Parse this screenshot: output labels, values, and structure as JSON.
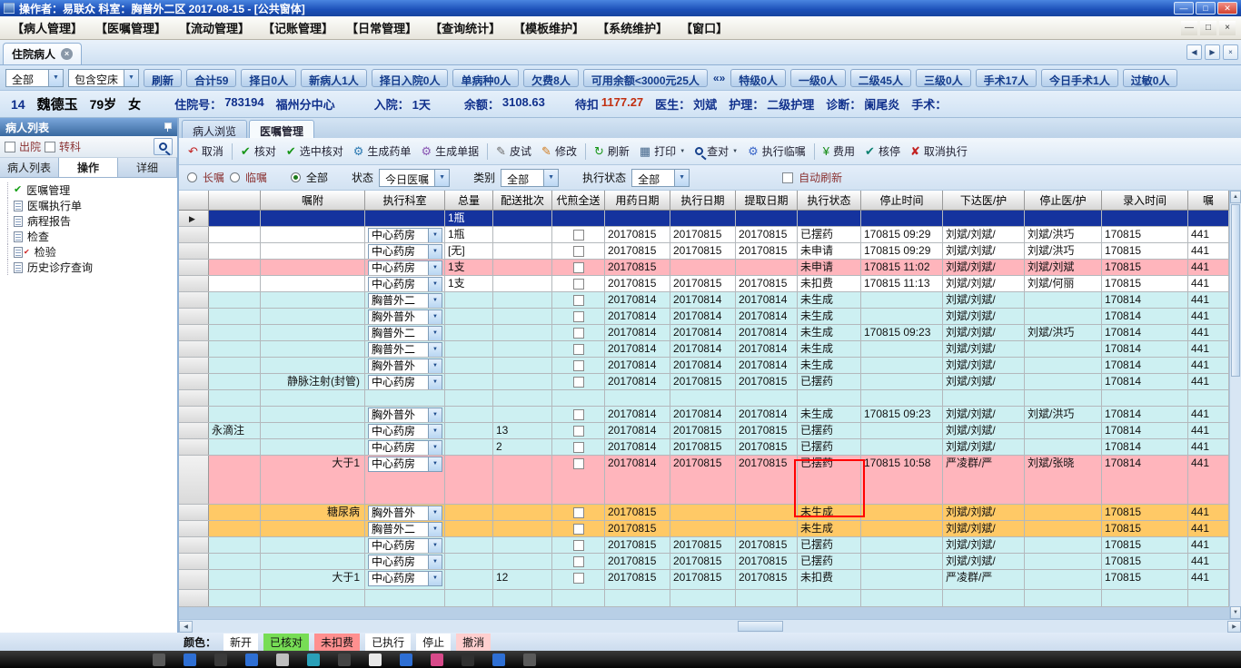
{
  "titlebar": {
    "title": "操作者：易联众 科室：胸普外二区 2017-08-15 - [公共窗体]",
    "min": "—",
    "max": "□",
    "close": "✕"
  },
  "menubar": {
    "items": [
      "【病人管理】",
      "【医嘱管理】",
      "【流动管理】",
      "【记账管理】",
      "【日常管理】",
      "【查询统计】",
      "【模板维护】",
      "【系统维护】",
      "【窗口】"
    ]
  },
  "doc_tabs": {
    "active": "住院病人"
  },
  "stats_bar": {
    "combos": [
      "全部",
      "包含空床"
    ],
    "buttons": [
      "刷新",
      "合计59",
      "择日0人",
      "新病人1人",
      "择日入院0人",
      "单病种0人",
      "欠费8人",
      "可用余额<3000元25人",
      "特级0人",
      "一级0人",
      "二级45人",
      "三级0人",
      "手术17人",
      "今日手术1人",
      "过敏0人"
    ],
    "more": "«»"
  },
  "patientbar": {
    "bed": "14",
    "name": "魏德玉",
    "age": "79岁",
    "sex": "女",
    "adm_label": "住院号：",
    "adm_no": "783194",
    "center": "福州分中心",
    "in_label": "入院：",
    "in_val": "1天",
    "bal_label": "余额：",
    "bal_val": "3108.63",
    "wait_label": "待扣",
    "wait_val": "1177.27",
    "doc_label": "医生：",
    "doc_val": "刘斌",
    "nurse_label": "护理：",
    "nurse_val": "二级护理",
    "diag_label": "诊断：",
    "diag_val": "阑尾炎",
    "op_label": "手术："
  },
  "sidebar": {
    "title": "病人列表",
    "checkboxes": [
      "出院",
      "转科"
    ],
    "tabs": [
      "病人列表",
      "操作",
      "详细"
    ],
    "tree": [
      {
        "label": "医嘱管理",
        "icon": "check"
      },
      {
        "label": "医嘱执行单",
        "icon": "doc"
      },
      {
        "label": "病程报告",
        "icon": "doc"
      },
      {
        "label": "检查",
        "icon": "doc"
      },
      {
        "label": "检验",
        "icon": "doc-red"
      },
      {
        "label": "历史诊疗查询",
        "icon": "doc"
      }
    ]
  },
  "main_tabs": {
    "items": [
      "病人浏览",
      "医嘱管理"
    ]
  },
  "order_toolbar": {
    "items": [
      {
        "name": "cancel",
        "label": "取消",
        "icon": "undo"
      },
      {
        "name": "verify",
        "label": "核对",
        "icon": "check",
        "sep": true
      },
      {
        "name": "verify-selected",
        "label": "选中核对",
        "icon": "check"
      },
      {
        "name": "generate-med-list",
        "label": "生成药单",
        "icon": "gear"
      },
      {
        "name": "generate-doc",
        "label": "生成单据",
        "icon": "gear2"
      },
      {
        "name": "skin-test",
        "label": "皮试",
        "icon": "pencil",
        "sep": true
      },
      {
        "name": "modify",
        "label": "修改",
        "icon": "edit"
      },
      {
        "name": "refresh",
        "label": "刷新",
        "icon": "refresh",
        "sep": true
      },
      {
        "name": "print",
        "label": "打印",
        "icon": "print",
        "dropdown": true
      },
      {
        "name": "check-against",
        "label": "查对",
        "icon": "mag",
        "dropdown": true
      },
      {
        "name": "execute-stat-order",
        "label": "执行临嘱",
        "icon": "gear3"
      },
      {
        "name": "fee",
        "label": "费用",
        "icon": "money",
        "sep": true
      },
      {
        "name": "verify-stop",
        "label": "核停",
        "icon": "stopcheck"
      },
      {
        "name": "cancel-execute",
        "label": "取消执行",
        "icon": "cancel"
      }
    ]
  },
  "filter_row": {
    "radios": [
      {
        "label": "长嘱",
        "on": false
      },
      {
        "label": "临嘱",
        "on": false
      },
      {
        "label": "全部",
        "on": true
      }
    ],
    "selects": [
      {
        "label": "状态",
        "value": "今日医嘱"
      },
      {
        "label": "类别",
        "value": "全部"
      },
      {
        "label": "执行状态",
        "value": "全部"
      }
    ],
    "auto_refresh": "自动刷新"
  },
  "table": {
    "columns": [
      "",
      "",
      "嘱附",
      "执行科室",
      "总量",
      "配送批次",
      "代煎全送",
      "用药日期",
      "执行日期",
      "提取日期",
      "执行状态",
      "停止时间",
      "下达医/护",
      "停止医/护",
      "录入时间",
      "嘱"
    ],
    "rows": [
      {
        "h": 18,
        "bg": "sel",
        "sel": true,
        "qty": "1瓶"
      },
      {
        "h": 18,
        "bg": "white",
        "dept": "中心药房",
        "qty": "1瓶",
        "chk": true,
        "d1": "20170815",
        "d2": "20170815",
        "d3": "20170815",
        "st": "已摆药",
        "stop": "170815 09:29",
        "doc": "刘斌/刘斌/",
        "sdoc": "刘斌/洪巧",
        "entry": "170815",
        "z": "441"
      },
      {
        "h": 18,
        "bg": "white",
        "dept": "中心药房",
        "qty": "[无]",
        "chk": true,
        "d1": "20170815",
        "d2": "20170815",
        "d3": "20170815",
        "st": "未申请",
        "stop": "170815 09:29",
        "doc": "刘斌/刘斌/",
        "sdoc": "刘斌/洪巧",
        "entry": "170815",
        "z": "441"
      },
      {
        "h": 18,
        "bg": "pink",
        "dept": "中心药房",
        "qty": "1支",
        "chk": true,
        "d1": "20170815",
        "st": "未申请",
        "stop": "170815 11:02",
        "doc": "刘斌/刘斌/",
        "sdoc": "刘斌/刘斌",
        "entry": "170815",
        "z": "441"
      },
      {
        "h": 18,
        "bg": "white",
        "dept": "中心药房",
        "qty": "1支",
        "chk": true,
        "d1": "20170815",
        "d2": "20170815",
        "d3": "20170815",
        "st": "未扣费",
        "stop": "170815 11:13",
        "doc": "刘斌/刘斌/",
        "sdoc": "刘斌/何丽",
        "entry": "170815",
        "z": "441"
      },
      {
        "h": 18,
        "bg": "cyan",
        "dept": "胸普外二",
        "chk": true,
        "d1": "20170814",
        "d2": "20170814",
        "d3": "20170814",
        "st": "未生成",
        "doc": "刘斌/刘斌/",
        "entry": "170814",
        "z": "441"
      },
      {
        "h": 18,
        "bg": "cyan",
        "dept": "胸外普外",
        "chk": true,
        "d1": "20170814",
        "d2": "20170814",
        "d3": "20170814",
        "st": "未生成",
        "doc": "刘斌/刘斌/",
        "entry": "170814",
        "z": "441"
      },
      {
        "h": 18,
        "bg": "cyan",
        "dept": "胸普外二",
        "chk": true,
        "d1": "20170814",
        "d2": "20170814",
        "d3": "20170814",
        "st": "未生成",
        "stop": "170815 09:23",
        "doc": "刘斌/刘斌/",
        "sdoc": "刘斌/洪巧",
        "entry": "170814",
        "z": "441"
      },
      {
        "h": 18,
        "bg": "cyan",
        "dept": "胸普外二",
        "chk": true,
        "d1": "20170814",
        "d2": "20170814",
        "d3": "20170814",
        "st": "未生成",
        "doc": "刘斌/刘斌/",
        "entry": "170814",
        "z": "441"
      },
      {
        "h": 18,
        "bg": "cyan",
        "dept": "胸外普外",
        "chk": true,
        "d1": "20170814",
        "d2": "20170814",
        "d3": "20170814",
        "st": "未生成",
        "doc": "刘斌/刘斌/",
        "entry": "170814",
        "z": "441"
      },
      {
        "h": 18,
        "bg": "cyan",
        "note": "静脉注射(封管)",
        "dept": "中心药房",
        "chk": true,
        "d1": "20170814",
        "d2": "20170815",
        "d3": "20170815",
        "st": "已摆药",
        "doc": "刘斌/刘斌/",
        "entry": "170814",
        "z": "441"
      },
      {
        "h": 18,
        "bg": "cyan"
      },
      {
        "h": 18,
        "bg": "cyan",
        "dept": "胸外普外",
        "chk": true,
        "d1": "20170814",
        "d2": "20170814",
        "d3": "20170814",
        "st": "未生成",
        "stop": "170815 09:23",
        "doc": "刘斌/刘斌/",
        "sdoc": "刘斌/洪巧",
        "entry": "170814",
        "z": "441"
      },
      {
        "h": 18,
        "bg": "cyan",
        "colA": "永滴注",
        "dept": "中心药房",
        "batch": "13",
        "chk": true,
        "d1": "20170814",
        "d2": "20170815",
        "d3": "20170815",
        "st": "已摆药",
        "doc": "刘斌/刘斌/",
        "entry": "170814",
        "z": "441"
      },
      {
        "h": 18,
        "bg": "cyan",
        "dept": "中心药房",
        "batch": "2",
        "chk": true,
        "d1": "20170814",
        "d2": "20170815",
        "d3": "20170815",
        "st": "已摆药",
        "doc": "刘斌/刘斌/",
        "entry": "170814",
        "z": "441"
      },
      {
        "h": 54,
        "bg": "pink",
        "note": "大于1",
        "dept": "中心药房",
        "chk": true,
        "d1": "20170814",
        "d2": "20170815",
        "d3": "20170815",
        "st": "已摆药",
        "stop": "170815 10:58",
        "doc": "严凌群/严",
        "sdoc": "刘斌/张晓",
        "entry": "170814",
        "z": "441"
      },
      {
        "h": 18,
        "bg": "orange",
        "note": "糖尿病",
        "dept": "胸外普外",
        "chk": true,
        "d1": "20170815",
        "st": "未生成",
        "doc": "刘斌/刘斌/",
        "entry": "170815",
        "z": "441"
      },
      {
        "h": 18,
        "bg": "orange",
        "dept": "胸普外二",
        "chk": true,
        "d1": "20170815",
        "st": "未生成",
        "doc": "刘斌/刘斌/",
        "entry": "170815",
        "z": "441"
      },
      {
        "h": 18,
        "bg": "cyan",
        "dept": "中心药房",
        "chk": true,
        "d1": "20170815",
        "d2": "20170815",
        "d3": "20170815",
        "st": "已摆药",
        "doc": "刘斌/刘斌/",
        "entry": "170815",
        "z": "441"
      },
      {
        "h": 18,
        "bg": "cyan",
        "dept": "中心药房",
        "chk": true,
        "d1": "20170815",
        "d2": "20170815",
        "d3": "20170815",
        "st": "已摆药",
        "doc": "刘斌/刘斌/",
        "entry": "170815",
        "z": "441"
      },
      {
        "h": 22,
        "bg": "cyan",
        "note": "大于1",
        "dept": "中心药房",
        "batch": "12",
        "chk": true,
        "d1": "20170815",
        "d2": "20170815",
        "d3": "20170815",
        "st": "未扣费",
        "doc": "严凌群/严",
        "entry": "170815",
        "z": "441"
      },
      {
        "h": 19,
        "bg": "cyan"
      }
    ]
  },
  "legend": {
    "label": "颜色：",
    "items": [
      {
        "label": "新开",
        "bg": "#ffffff"
      },
      {
        "label": "已核对",
        "bg": "#77dd55"
      },
      {
        "label": "未扣费",
        "bg": "#ff8f8f"
      },
      {
        "label": "已执行",
        "bg": "#ffffff"
      },
      {
        "label": "停止",
        "bg": "#ffffff"
      },
      {
        "label": "撤消",
        "bg": "#ffcfcf"
      }
    ]
  },
  "colors": {
    "selection": "#15339e",
    "row_cyan": "#cdf0f2",
    "row_pink": "#ffb5bc",
    "row_orange": "#ffc966",
    "annotation": "#ff0000"
  },
  "taskbar": {
    "icons": [
      "#5a5a5a",
      "#2e6fd4",
      "#3a3a3a",
      "#2e6fd4",
      "#bfbfbf",
      "#2aa0b8",
      "#444444",
      "#e8e8e8",
      "#2e6fd4",
      "#d84a8a",
      "#303030",
      "#2e6fd4",
      "#5a5a5a"
    ]
  }
}
